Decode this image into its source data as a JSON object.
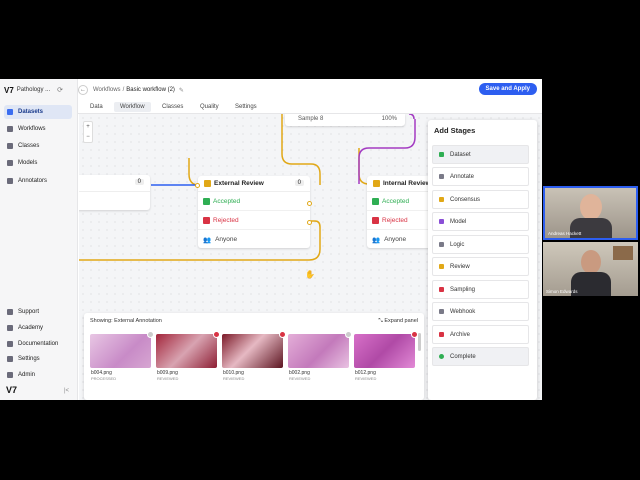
{
  "app": {
    "logo": "V7",
    "workspace": "Pathology ..."
  },
  "sidebar": {
    "items": [
      {
        "label": "Datasets",
        "icon": "database-icon",
        "active": true
      },
      {
        "label": "Workflows",
        "icon": "workflow-icon"
      },
      {
        "label": "Classes",
        "icon": "tag-icon"
      },
      {
        "label": "Models",
        "icon": "model-icon"
      },
      {
        "label": "Annotators",
        "icon": "users-icon"
      }
    ],
    "bottom": [
      {
        "label": "Support",
        "icon": "help-icon"
      },
      {
        "label": "Academy",
        "icon": "academy-icon"
      },
      {
        "label": "Documentation",
        "icon": "doc-icon"
      },
      {
        "label": "Settings",
        "icon": "gear-icon"
      },
      {
        "label": "Admin",
        "icon": "admin-icon"
      }
    ],
    "collapse": "|<"
  },
  "breadcrumb": {
    "root": "Workflows",
    "sep": "/",
    "current": "Basic workflow (2)"
  },
  "save_button": "Save and Apply",
  "tabs": [
    "Data",
    "Workflow",
    "Classes",
    "Quality",
    "Settings"
  ],
  "active_tab": "Workflow",
  "canvas": {
    "zoom_in": "+",
    "zoom_out": "−",
    "left_node_count": "0",
    "sample_node": {
      "label": "Sample 8",
      "value": "100%"
    },
    "external_review": {
      "title": "External Review",
      "count": "0",
      "accepted": "Accepted",
      "rejected": "Rejected",
      "assignee": "Anyone"
    },
    "internal_review": {
      "title": "Internal Review",
      "accepted": "Accepted",
      "rejected": "Rejected",
      "assignee": "Anyone"
    }
  },
  "add_stages": {
    "title": "Add Stages",
    "items": [
      {
        "label": "Dataset",
        "color": "#2fae53"
      },
      {
        "label": "Annotate",
        "color": "#7a7a88"
      },
      {
        "label": "Consensus",
        "color": "#e1a817"
      },
      {
        "label": "Model",
        "color": "#8a4fd6"
      },
      {
        "label": "Logic",
        "color": "#7a7a88"
      },
      {
        "label": "Review",
        "color": "#e1a817"
      },
      {
        "label": "Sampling",
        "color": "#d93344"
      },
      {
        "label": "Webhook",
        "color": "#7a7a88"
      },
      {
        "label": "Archive",
        "color": "#d93344"
      },
      {
        "label": "Complete",
        "color": "#2fae53"
      }
    ]
  },
  "gallery": {
    "showing": "Showing: External Annotation",
    "expand": "Expand panel",
    "images": [
      {
        "name": "b004.png",
        "sub": "PROCESSED"
      },
      {
        "name": "b009.png",
        "sub": "REVIEWED"
      },
      {
        "name": "b010.png",
        "sub": "REVIEWED"
      },
      {
        "name": "b002.png",
        "sub": "REVIEWED"
      },
      {
        "name": "b012.png",
        "sub": "REVIEWED"
      }
    ]
  },
  "video": {
    "person1": "Andreas Hackett",
    "person2": "Simon Edwards"
  },
  "colors": {
    "accent": "#2d5ef0",
    "review_line": "#e1a817",
    "model_line": "#a33bc2"
  }
}
